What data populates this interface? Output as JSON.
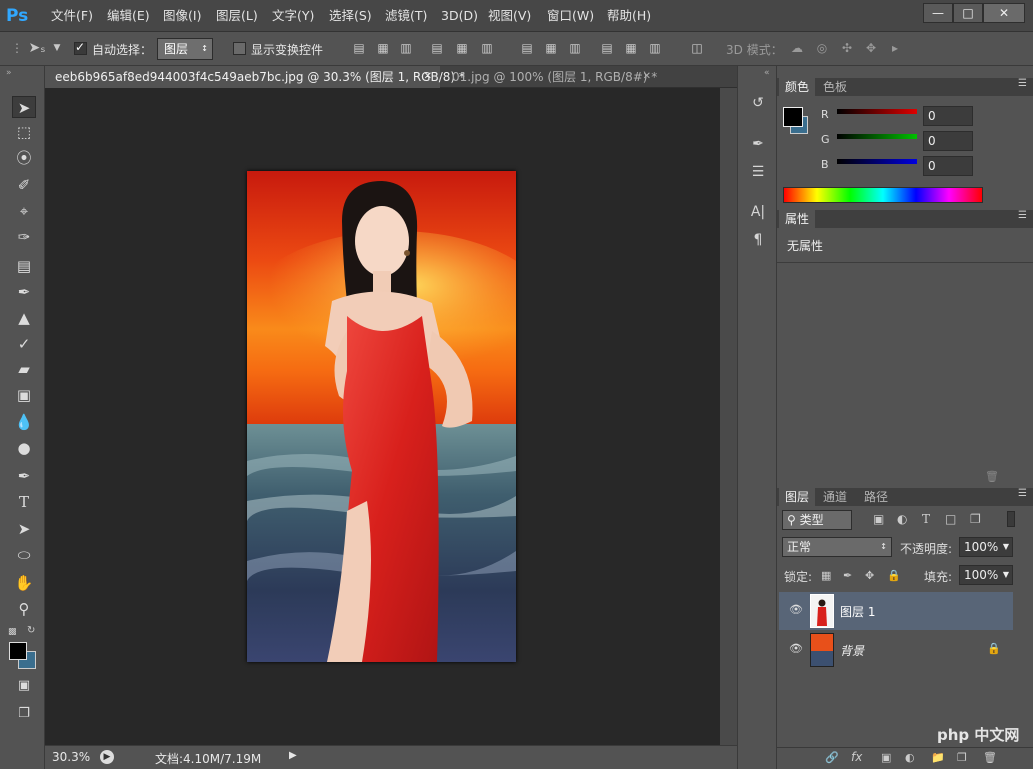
{
  "app": {
    "logo": "Ps"
  },
  "menubar": {
    "items": [
      "文件(F)",
      "编辑(E)",
      "图像(I)",
      "图层(L)",
      "文字(Y)",
      "选择(S)",
      "滤镜(T)",
      "3D(D)",
      "视图(V)",
      "窗口(W)",
      "帮助(H)"
    ],
    "window_buttons": [
      "minimize-icon",
      "restore-icon",
      "close-icon"
    ]
  },
  "options_bar": {
    "auto_select_label": "自动选择：",
    "auto_select_checked": true,
    "target_value": "图层",
    "show_transform_label": "显示变换控件",
    "show_transform_checked": false,
    "mode_3d_label": "3D 模式："
  },
  "document_tabs": [
    {
      "label": "eeb6b965af8ed944003f4c549aeb7bc.jpg @ 30.3% (图层 1, RGB/8) *",
      "active": true
    },
    {
      "label": "01.jpg @ 100% (图层 1, RGB/8#) *",
      "active": false
    }
  ],
  "status_bar": {
    "zoom": "30.3%",
    "doc_info": "文档:4.10M/7.19M"
  },
  "color_panel": {
    "tabs": [
      "颜色",
      "色板"
    ],
    "channels": [
      {
        "label": "R",
        "value": "0",
        "color": "#e00000"
      },
      {
        "label": "G",
        "value": "0",
        "color": "#00c000"
      },
      {
        "label": "B",
        "value": "0",
        "color": "#0000e0"
      }
    ]
  },
  "properties_panel": {
    "tab": "属性",
    "empty_text": "无属性"
  },
  "layers_panel": {
    "tabs": [
      "图层",
      "通道",
      "路径"
    ],
    "filter_kind": "类型",
    "blend_mode": "正常",
    "opacity_label": "不透明度:",
    "opacity_value": "100%",
    "lock_label": "锁定:",
    "fill_label": "填充:",
    "fill_value": "100%",
    "layers": [
      {
        "name": "图层 1",
        "selected": true,
        "locked": false
      },
      {
        "name": "背景",
        "selected": false,
        "locked": true
      }
    ]
  },
  "watermark": "php 中文网",
  "colors": {
    "ui_bg": "#535353",
    "canvas_bg": "#282828",
    "accent": "#31a8ff",
    "selected_layer": "#586577"
  }
}
